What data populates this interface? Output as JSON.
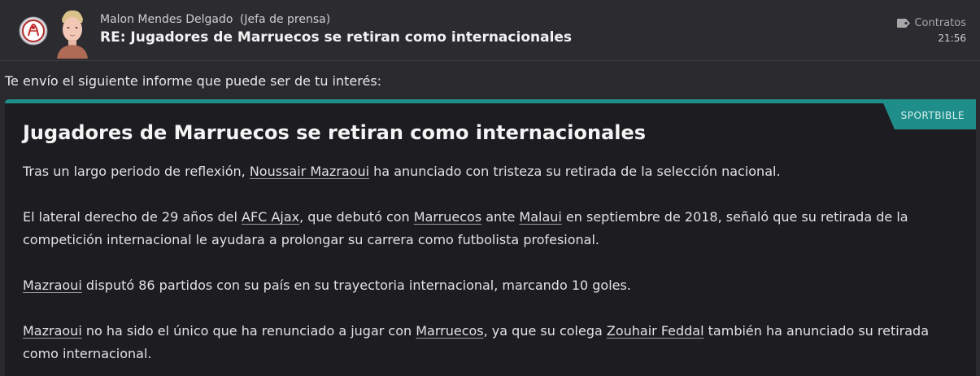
{
  "message": {
    "sender_name": "Malon Mendes Delgado",
    "sender_role": "(Jefa de prensa)",
    "subject": "RE: Jugadores de Marruecos se retiran como internacionales",
    "tag_label": "Contratos",
    "time": "21:56",
    "intro": "Te envío el siguiente informe que puede ser de tu interés:"
  },
  "article": {
    "source": "SPORTBIBLE",
    "title": "Jugadores de Marruecos se retiran como internacionales",
    "p1": {
      "a": "Tras un largo periodo de reflexión, ",
      "player": "Noussair Mazraoui",
      "b": " ha anunciado con tristeza su retirada de la selección nacional."
    },
    "p2": {
      "a": "El lateral derecho de 29 años del ",
      "club": "AFC Ajax",
      "b": ", que debutó con ",
      "team": "Marruecos",
      "c": " ante ",
      "opponent": "Malaui",
      "d": " en septiembre de 2018, señaló que su retirada de la competición internacional le ayudara a prolongar su carrera como futbolista profesional."
    },
    "p3": {
      "player": "Mazraoui",
      "a": " disputó 86 partidos con su país en su trayectoria internacional, marcando 10 goles."
    },
    "p4": {
      "player": "Mazraoui",
      "a": " no ha sido el único que ha renunciado a jugar con ",
      "team": "Marruecos",
      "b": ", ya que su colega ",
      "colleague": "Zouhair Feddal",
      "c": " también ha anunciado su retirada como internacional."
    }
  },
  "colors": {
    "accent": "#1f8e8a",
    "background": "#2a2a2e",
    "card": "#1d1c20"
  },
  "icons": {
    "club": "ajax-crest-icon",
    "tag": "tag-icon"
  }
}
